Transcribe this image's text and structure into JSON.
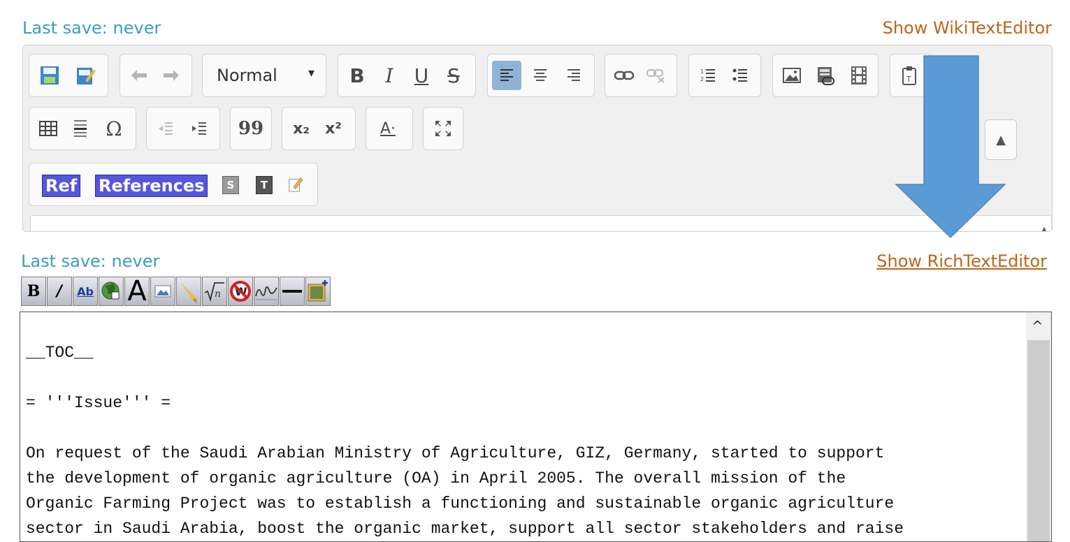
{
  "rich_editor": {
    "last_save": "Last save: never",
    "toggle_link": "Show WikiTextEditor",
    "format_select": "Normal",
    "buttons": {
      "bold": "B",
      "italic": "I",
      "underline": "U",
      "strike": "S",
      "omega": "Ω",
      "quote": "99",
      "subscript": "x₂",
      "superscript": "x²",
      "font_color": "A·"
    },
    "cite": {
      "ref": "Ref",
      "references": "References",
      "s": "S",
      "t": "T"
    }
  },
  "wiki_editor": {
    "last_save": "Last save: never",
    "toggle_link": "Show RichTextEditor",
    "buttons": {
      "bold": "B",
      "italic": "/",
      "link": "Ab",
      "big_a": "A"
    },
    "text": "__TOC__\n\n= '''Issue''' =\n\nOn request of the Saudi Arabian Ministry of Agriculture, GIZ, Germany, started to support\nthe development of organic agriculture (OA) in April 2005. The overall mission of the\nOrganic Farming Project was to establish a functioning and sustainable organic agriculture\nsector in Saudi Arabia, boost the organic market, support all sector stakeholders and raise"
  },
  "colors": {
    "accent_teal": "#3aa0b8",
    "link_orange": "#b8661c",
    "arrow_blue": "#5b9bd5",
    "cite_purple": "#5555dd"
  }
}
